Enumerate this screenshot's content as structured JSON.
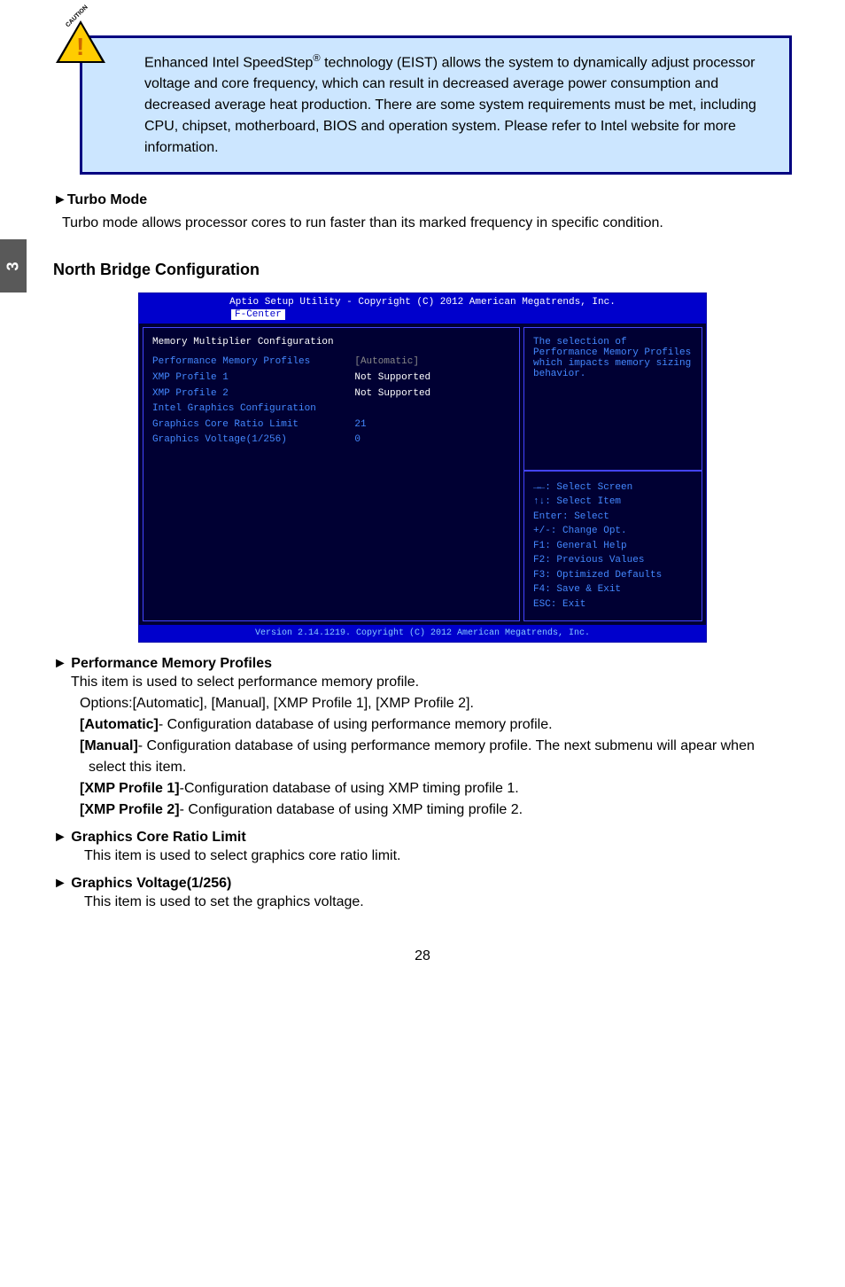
{
  "pageTab": "3",
  "caution": {
    "label": "CAUTION",
    "bang": "!",
    "text_l1_a": "Enhanced Intel SpeedStep",
    "text_l1_sup": "®",
    "text_l1_b": " technology (EIST) allows the system to dynamically adjust processor voltage and core frequency, which can result in decreased average power consumption and decreased average heat production.  There are some system requirements must be met, including CPU, chipset, motherboard, BIOS and operation system.  Please refer to Intel website for more information."
  },
  "turbo": {
    "heading": "►Turbo Mode",
    "body": "Turbo mode allows processor cores to run faster than its marked frequency in specific condition."
  },
  "northBridge": {
    "heading": "North Bridge Configuration"
  },
  "bios": {
    "header": "Aptio Setup Utility - Copyright (C) 2012 American Megatrends, Inc.",
    "fcenter": "F-Center",
    "left": {
      "title": "Memory Multiplier Configuration",
      "rows": [
        {
          "label": "Performance Memory Profiles",
          "value": "[Automatic]",
          "labelColor": "blue",
          "valueColor": "gray"
        },
        {
          "label": "XMP Profile 1",
          "value": "Not Supported",
          "labelColor": "blue",
          "valueColor": "white"
        },
        {
          "label": "XMP Profile 2",
          "value": "Not Supported",
          "labelColor": "blue",
          "valueColor": "white"
        },
        {
          "label": "",
          "value": "",
          "labelColor": "white",
          "valueColor": "white"
        },
        {
          "label": "Intel Graphics Configuration",
          "value": "",
          "labelColor": "blue",
          "valueColor": "white"
        },
        {
          "label": "",
          "value": "",
          "labelColor": "white",
          "valueColor": "white"
        },
        {
          "label": "Graphics Core Ratio Limit",
          "value": "21",
          "labelColor": "blue",
          "valueColor": "blue"
        },
        {
          "label": "Graphics Voltage(1/256)",
          "value": "0",
          "labelColor": "blue",
          "valueColor": "blue"
        }
      ]
    },
    "rightTop": "The selection of Performance Memory Profiles which impacts memory sizing behavior.",
    "rightBottom": [
      "→←: Select Screen",
      "↑↓: Select Item",
      "Enter: Select",
      "+/-: Change Opt.",
      "F1: General Help",
      "F2: Previous Values",
      "F3: Optimized Defaults",
      "F4: Save & Exit",
      "ESC: Exit"
    ],
    "footer": "Version 2.14.1219. Copyright (C) 2012 American Megatrends, Inc."
  },
  "perfMem": {
    "heading": "► Performance Memory Profiles",
    "line1": "This item is used to select performance memory profile.",
    "line2": "Options:[Automatic], [Manual], [XMP Profile 1], [XMP Profile 2].",
    "opts": [
      {
        "b": "[Automatic]",
        "t": "- Configuration database of using performance memory  profile."
      },
      {
        "b": "[Manual]",
        "t": "- Configuration database of using performance memory profile. The next submenu will apear when select this item."
      },
      {
        "b": "[XMP Profile 1]",
        "t": "-Configuration database of using XMP timing profile 1."
      },
      {
        "b": "[XMP Profile 2]",
        "t": "- Configuration database of using XMP timing profile 2."
      }
    ]
  },
  "gcrl": {
    "heading": "► Graphics Core Ratio Limit",
    "body": "This item is used to select graphics core ratio limit."
  },
  "gv": {
    "heading": "► Graphics Voltage(1/256)",
    "body": "This item is used to set the graphics voltage."
  },
  "pageNumber": "28"
}
